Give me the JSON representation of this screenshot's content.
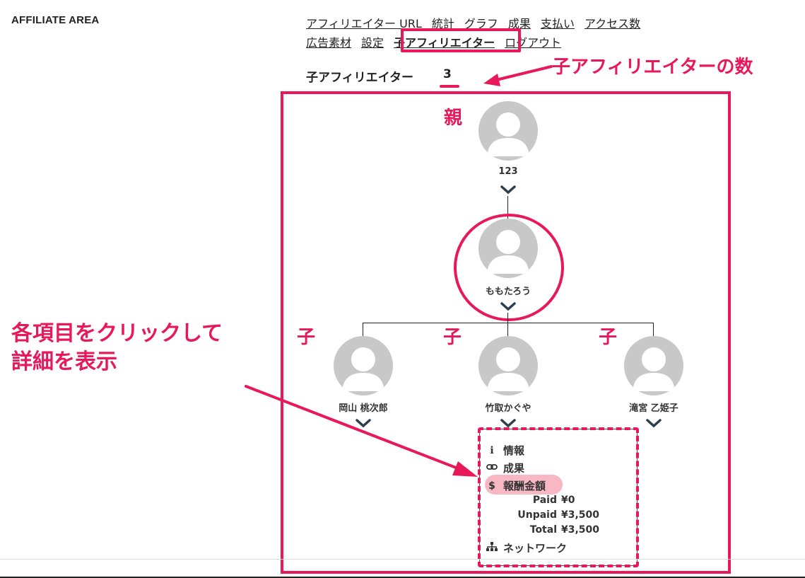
{
  "area_title": "AFFILIATE AREA",
  "nav": {
    "items": [
      {
        "label": "アフィリエイター URL"
      },
      {
        "label": "統計"
      },
      {
        "label": "グラフ"
      },
      {
        "label": "成果"
      },
      {
        "label": "支払い"
      },
      {
        "label": "アクセス数"
      },
      {
        "label": "広告素材"
      },
      {
        "label": "設定"
      },
      {
        "label": "子アフィリエイター",
        "active": true
      },
      {
        "label": "ログアウト"
      }
    ]
  },
  "child_count": {
    "label": "子アフィリエイター",
    "value": "3"
  },
  "callouts": {
    "count": "子アフィリエイターの数",
    "parent": "親",
    "child": "子",
    "click_line1": "各項目をクリックして",
    "click_line2": "詳細を表示"
  },
  "tree": {
    "root": {
      "name": "123"
    },
    "self": {
      "name": "ももたろう"
    },
    "children": [
      {
        "name": "岡山 桃次郎"
      },
      {
        "name": "竹取かぐや"
      },
      {
        "name": "滝宮 乙姫子"
      }
    ]
  },
  "detail_menu": {
    "info": "情報",
    "results": "成果",
    "reward": "報酬金額",
    "paid_label": "Paid",
    "paid_value": "¥0",
    "unpaid_label": "Unpaid",
    "unpaid_value": "¥3,500",
    "total_label": "Total",
    "total_value": "¥3,500",
    "network": "ネットワーク"
  },
  "colors": {
    "accent": "#e8195b",
    "highlight": "#f7b8c4",
    "avatar": "#c8c8c8"
  },
  "icons": {
    "info": "info-icon",
    "link": "link-icon",
    "dollar": "dollar-icon",
    "network": "sitemap-icon",
    "chevron": "chevron-down-icon"
  }
}
